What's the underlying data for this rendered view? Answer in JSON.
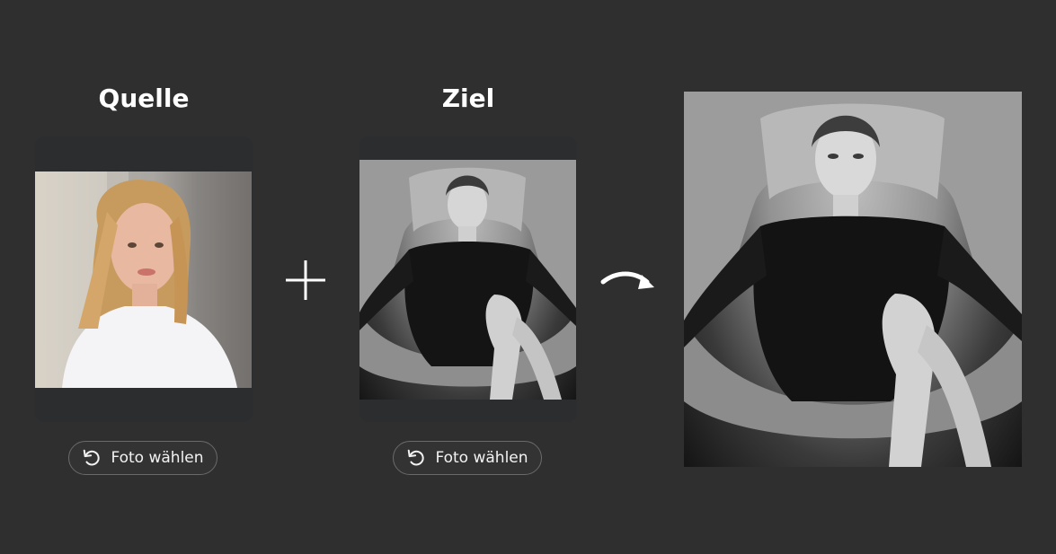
{
  "source": {
    "heading": "Quelle",
    "button_label": "Foto wählen",
    "button_icon": "rotate-ccw-icon",
    "photo_alt": "source-face-photo"
  },
  "target": {
    "heading": "Ziel",
    "button_label": "Foto wählen",
    "button_icon": "rotate-ccw-icon",
    "photo_alt": "target-photo"
  },
  "operators": {
    "combine_icon": "plus-icon",
    "result_icon": "curved-arrow-icon"
  },
  "result": {
    "photo_alt": "result-photo"
  },
  "colors": {
    "background": "#2f2f2f",
    "card": "#2c2d2f",
    "text": "#ffffff",
    "button_border": "#6a6a6a"
  }
}
